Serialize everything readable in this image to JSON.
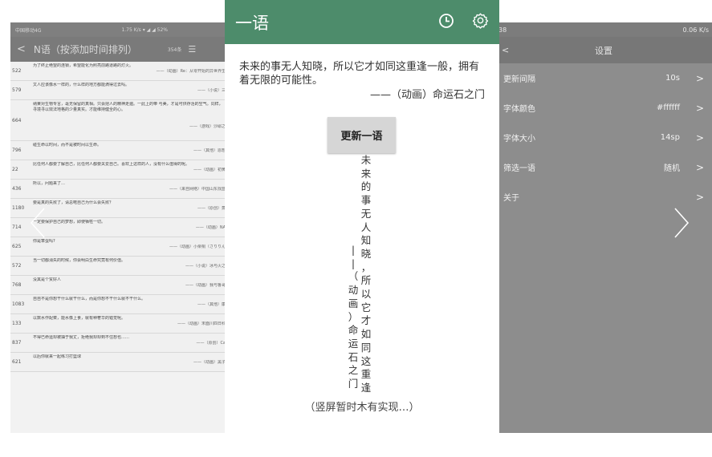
{
  "left_screen": {
    "status_left": "中国移动4G",
    "status_right": "1.75 K/s  ▾ ◢ ◢  52%",
    "title": "N语（按添加时间排列）",
    "count": "354条",
    "rows": [
      {
        "num": "522",
        "text": "为了终止绝望的连锁，希望能化为照亮前路道路的灯火。",
        "source": "——（动画）Re：从零开始的异世界生"
      },
      {
        "num": "579",
        "text": "文人应该像水一样的，什么样的地方都能滴得过去吗。",
        "source": "——（小说）三"
      },
      {
        "num": "664",
        "text": "纳莱对生物专言，毫无保留的真相。只会把人的精神走遍。一此上的带 与美，才是可供存活的空气。同样，寻境寻以效法地格的少量真实。才能维持健全的心。",
        "source": "——（游戏）沙耶之"
      },
      {
        "num": "796",
        "text": "碰生命以时间，而不是被时间以生命。",
        "source": "——（其他）恩想"
      },
      {
        "num": "22",
        "text": "比任何人都要了解自己，比任何人都要关爱自己。喜欢上这样的人，没有什么值得的呢。",
        "source": "——（动画）初黄"
      },
      {
        "num": "436",
        "text": "所以，问题来了…",
        "source": "——（来自网络）中国山东找蓝"
      },
      {
        "num": "1180",
        "text": "要是真的失败了，请总喏自己为什么会失败？",
        "source": "——（原创）蒸"
      },
      {
        "num": "714",
        "text": "一定要保护自己的梦想，即使牺牲一切。",
        "source": "——（动画）NA"
      },
      {
        "num": "625",
        "text": "你是笨蛋吗?",
        "source": "——（动画）小栗桐（さりりん"
      },
      {
        "num": "572",
        "text": "当一切都消失的时候，你会明白生命究竟有何价值。",
        "source": "——（小说）冰与火之"
      },
      {
        "num": "768",
        "text": "没其是个贫好人",
        "source": "——（动画）我与鲁哥"
      },
      {
        "num": "1083",
        "text": "自自不是你想干什么就干什么，而是你想不干什么就不干什么。",
        "source": "——（其他）康"
      },
      {
        "num": "133",
        "text": "以数水作配菜，能水像上食，就有种奢华的错觉呢。",
        "source": "——（动画）末面川四日科"
      },
      {
        "num": "837",
        "text": "不得已命运却被抽于我丈，拒绝我却却到不住想也……",
        "source": "——（原创）Ca"
      },
      {
        "num": "621",
        "text": "以后你就来一起练习打篮球",
        "source": "——（动画）黑子"
      }
    ]
  },
  "center_screen": {
    "title": "一语",
    "hitokoto": "未来的事无人知晓，所以它才如同这重逢一般，拥有着无限的可能性。",
    "source": "——（动画）命运石之门",
    "refresh_label": "更新一语",
    "vertical_col1": "未来的事无人知晓，所以它才如同这重逢",
    "vertical_col2": "——（动画）命运石之门",
    "notice": "（竖屏暂时木有实现…）",
    "accent_color": "#4d8c6b"
  },
  "right_screen": {
    "status_left": "38",
    "status_right": "0.06 K/s",
    "title": "设置",
    "settings": [
      {
        "label": "更新间隔",
        "value": "10s"
      },
      {
        "label": "字体颜色",
        "value": "#ffffff"
      },
      {
        "label": "字体大小",
        "value": "14sp"
      },
      {
        "label": "筛选一语",
        "value": "随机"
      },
      {
        "label": "关于",
        "value": ""
      }
    ]
  },
  "icons": {
    "history": "clock-icon",
    "settings": "gear-icon",
    "prev": "chevron-left-icon",
    "next": "chevron-right-icon"
  }
}
